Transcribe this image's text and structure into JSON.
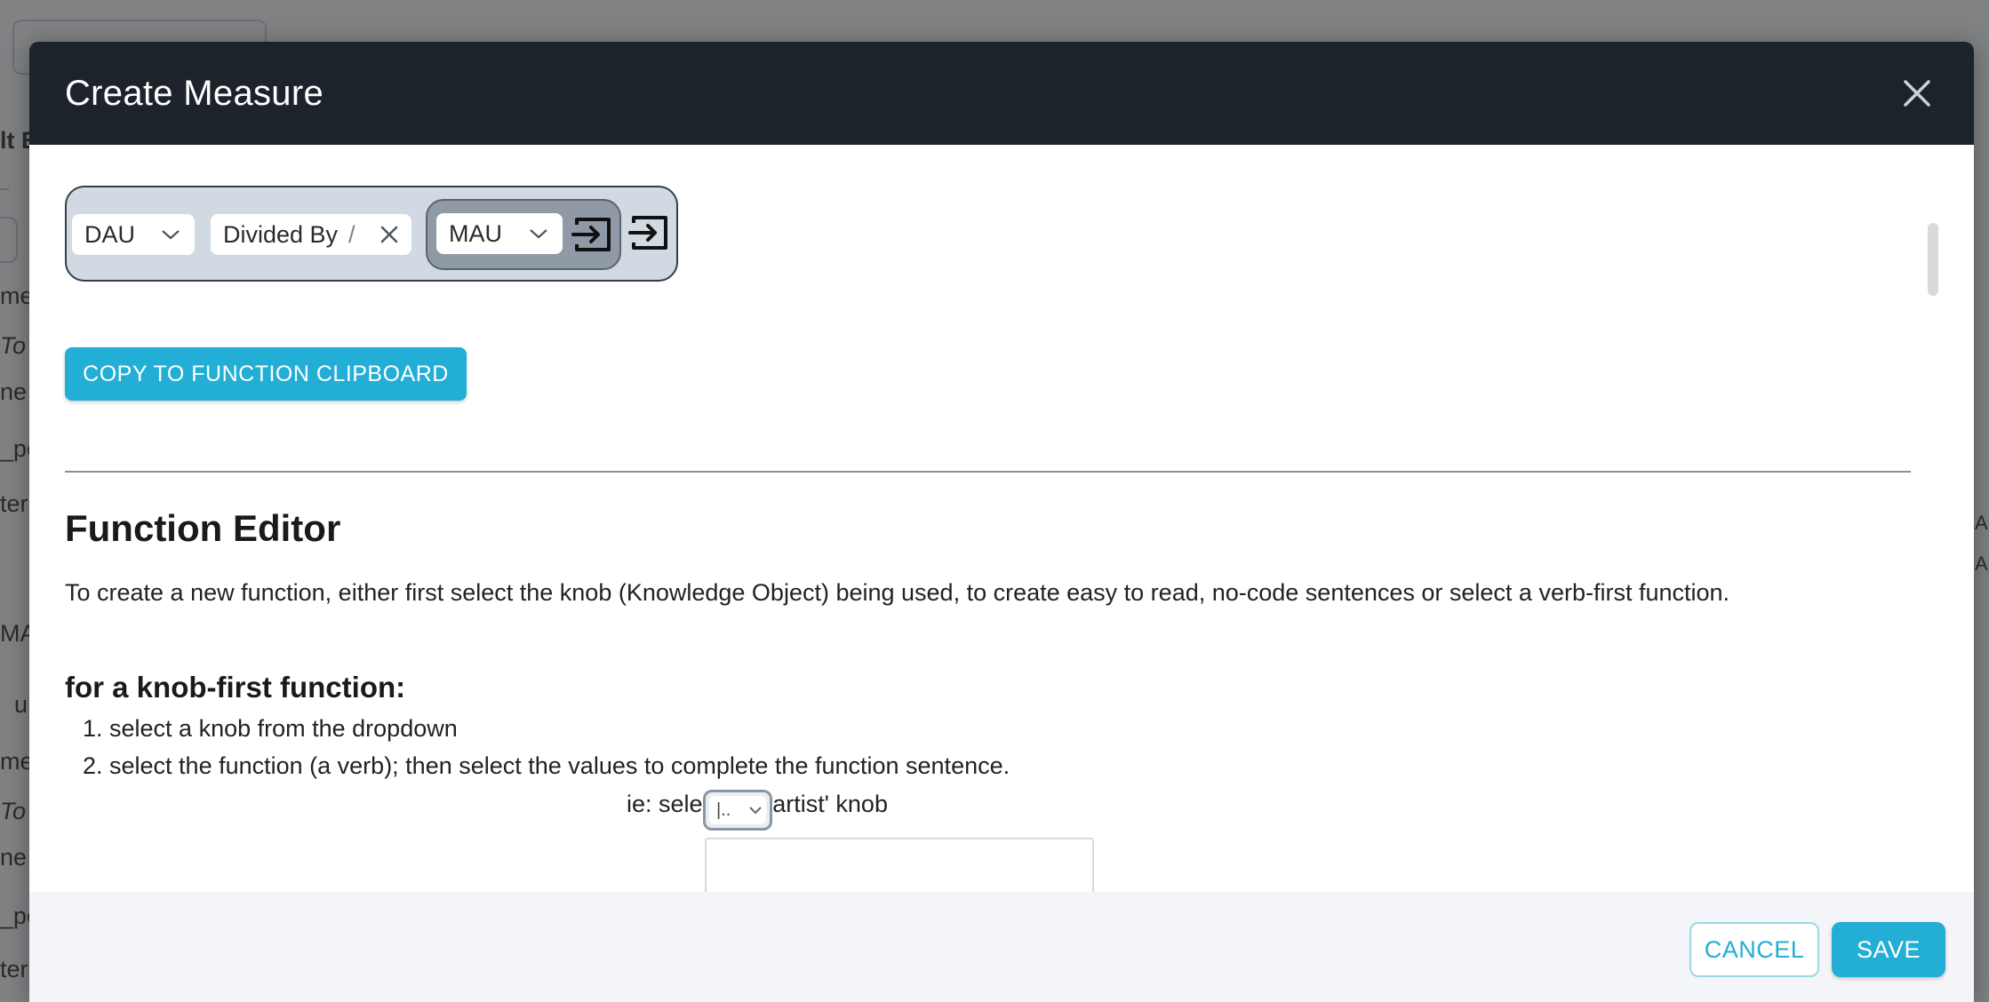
{
  "background": {
    "fragments": [
      "lt E",
      "me",
      "To",
      "ne a",
      "_pe",
      "ter",
      "MA",
      "u",
      "me",
      "To",
      "ne a",
      "_pe",
      "ter",
      "AU",
      "AU"
    ]
  },
  "modal": {
    "title": "Create Measure",
    "builder": {
      "first_select": "DAU",
      "operator": "Divided By",
      "operator_symbol": "/",
      "second_select": "MAU"
    },
    "copy_button": "COPY TO FUNCTION CLIPBOARD",
    "editor_heading": "Function Editor",
    "intro": "To create a new function, either first select the knob (Knowledge Object) being used, to create easy to read, no-code sentences or select a verb-first function.",
    "knob_heading": "for a knob-first function:",
    "steps": [
      "1. select a knob from the dropdown",
      "2. select the function (a verb); then select the values to complete the function sentence."
    ],
    "example": "ie: select the 'artist' knob",
    "mini_select_value": "|..",
    "cancel": "CANCEL",
    "save": "SAVE"
  },
  "colors": {
    "header_bg": "#1c232a",
    "accent": "#23aed5",
    "builder_bg": "#d1d9e2"
  }
}
